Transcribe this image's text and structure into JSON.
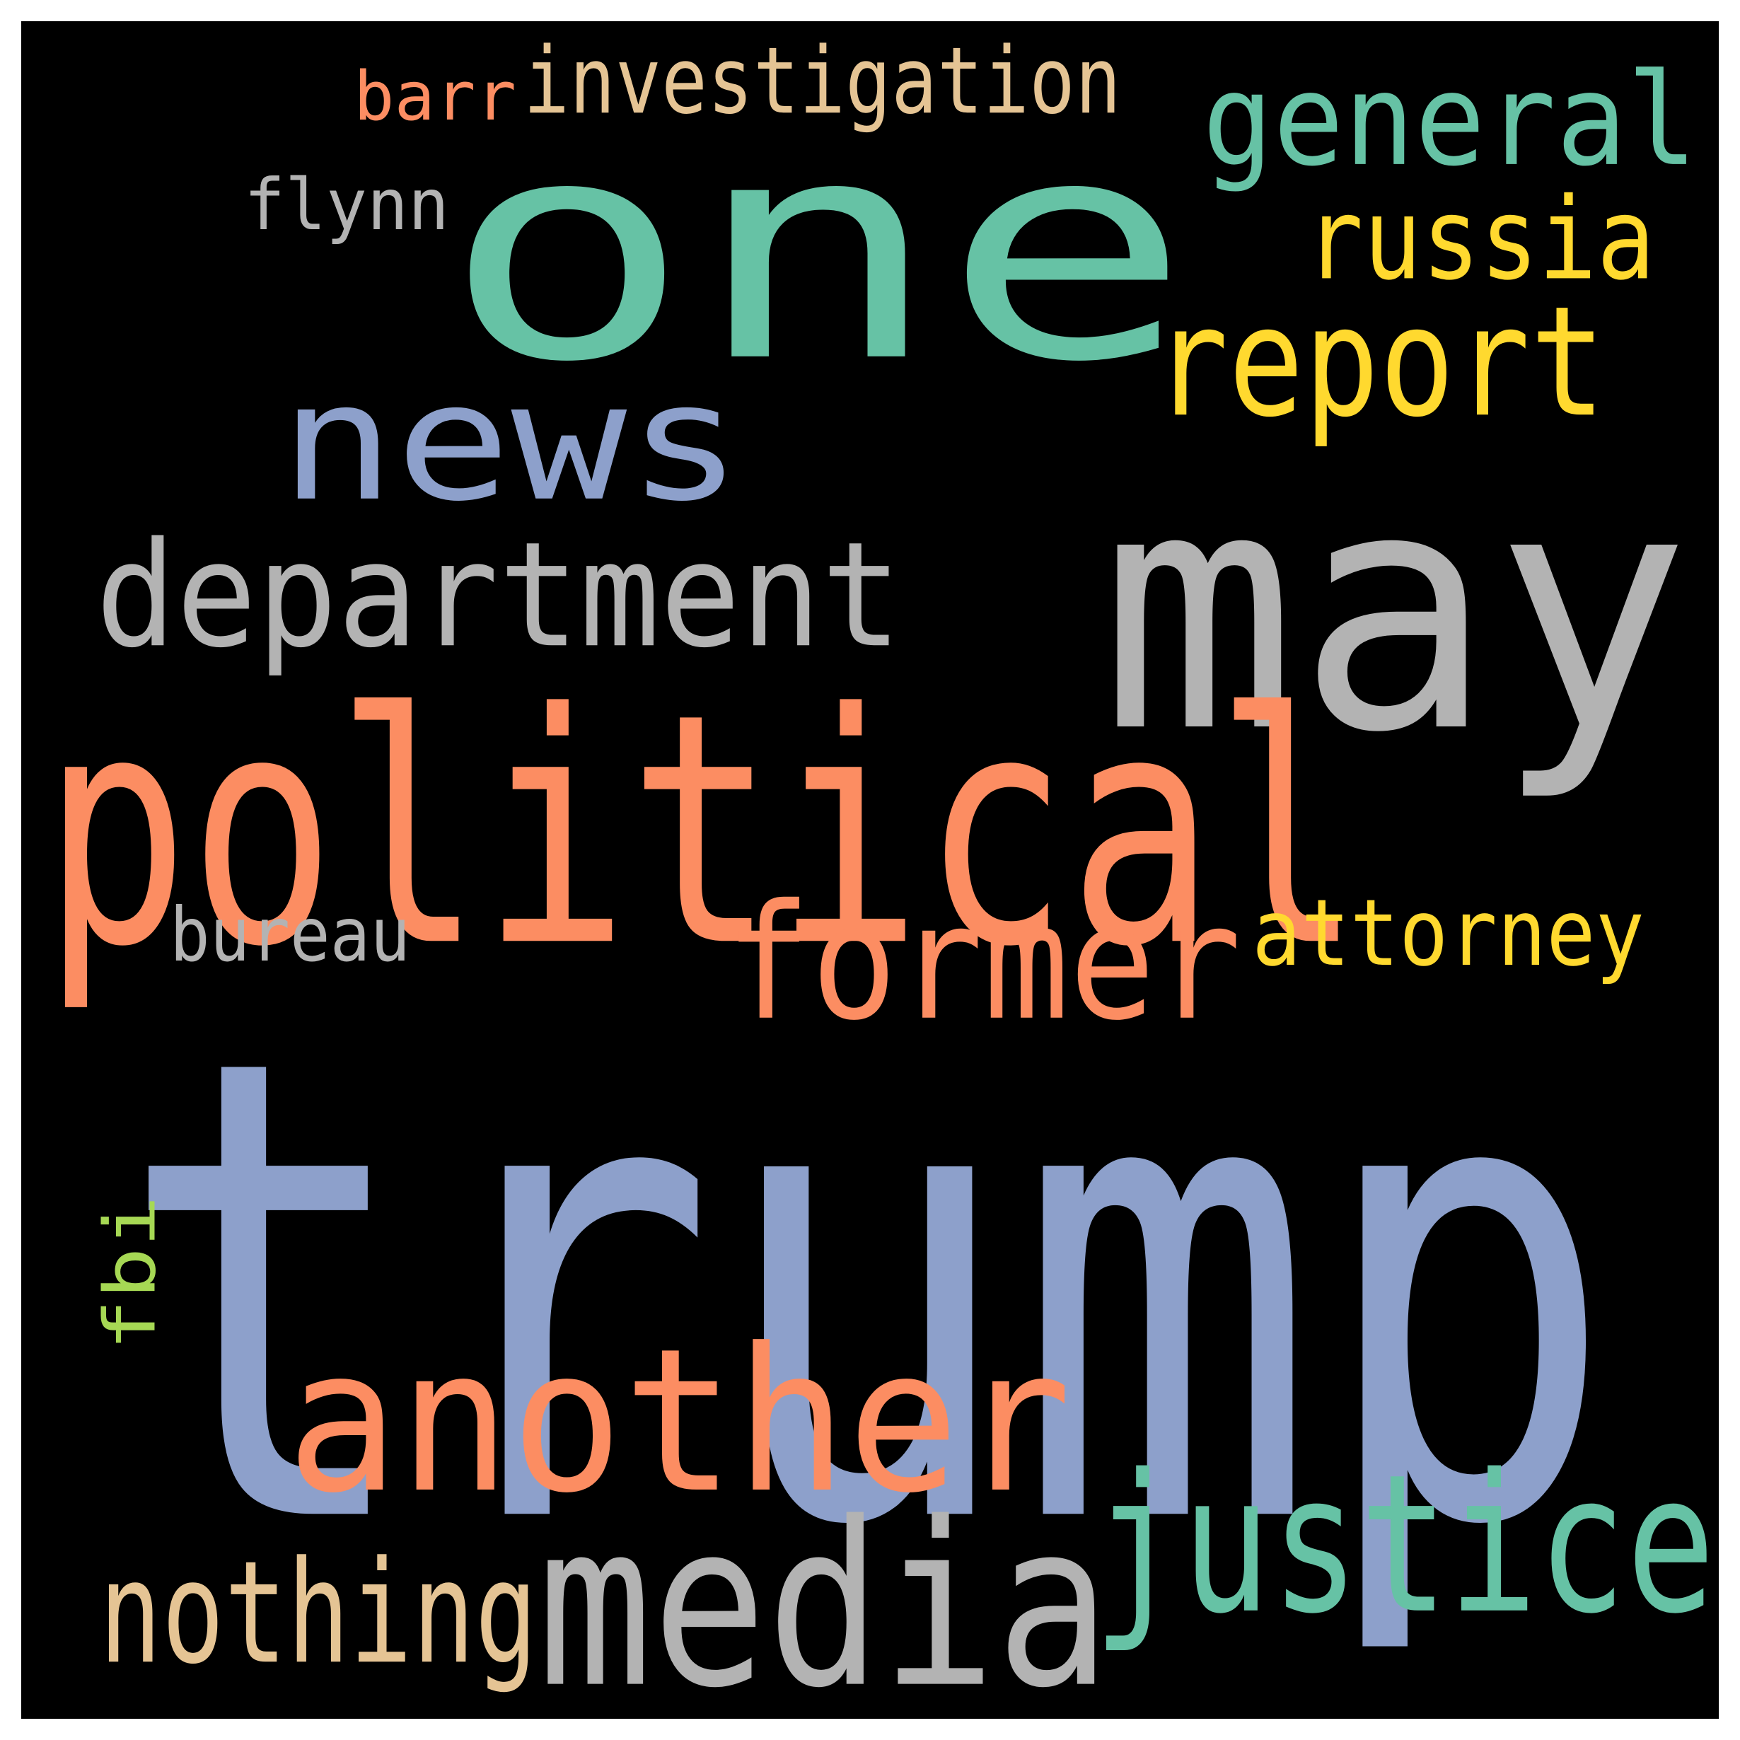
{
  "background": "#000000",
  "words": [
    {
      "text": "trump",
      "color": "#8da0cb"
    },
    {
      "text": "one",
      "color": "#66c2a5"
    },
    {
      "text": "may",
      "color": "#b3b3b3"
    },
    {
      "text": "political",
      "color": "#fc8d62"
    },
    {
      "text": "news",
      "color": "#8da0cb"
    },
    {
      "text": "department",
      "color": "#b3b3b3"
    },
    {
      "text": "another",
      "color": "#fc8d62"
    },
    {
      "text": "media",
      "color": "#b3b3b3"
    },
    {
      "text": "justice",
      "color": "#66c2a5"
    },
    {
      "text": "general",
      "color": "#66c2a5"
    },
    {
      "text": "report",
      "color": "#ffd92f"
    },
    {
      "text": "former",
      "color": "#fc8d62"
    },
    {
      "text": "russia",
      "color": "#ffd92f"
    },
    {
      "text": "investigation",
      "color": "#e5c494"
    },
    {
      "text": "nothing",
      "color": "#e5c494"
    },
    {
      "text": "attorney",
      "color": "#ffd92f"
    },
    {
      "text": "bureau",
      "color": "#b3b3b3"
    },
    {
      "text": "flynn",
      "color": "#b3b3b3"
    },
    {
      "text": "barr",
      "color": "#fc8d62"
    },
    {
      "text": "fbi",
      "color": "#a6d854"
    }
  ]
}
